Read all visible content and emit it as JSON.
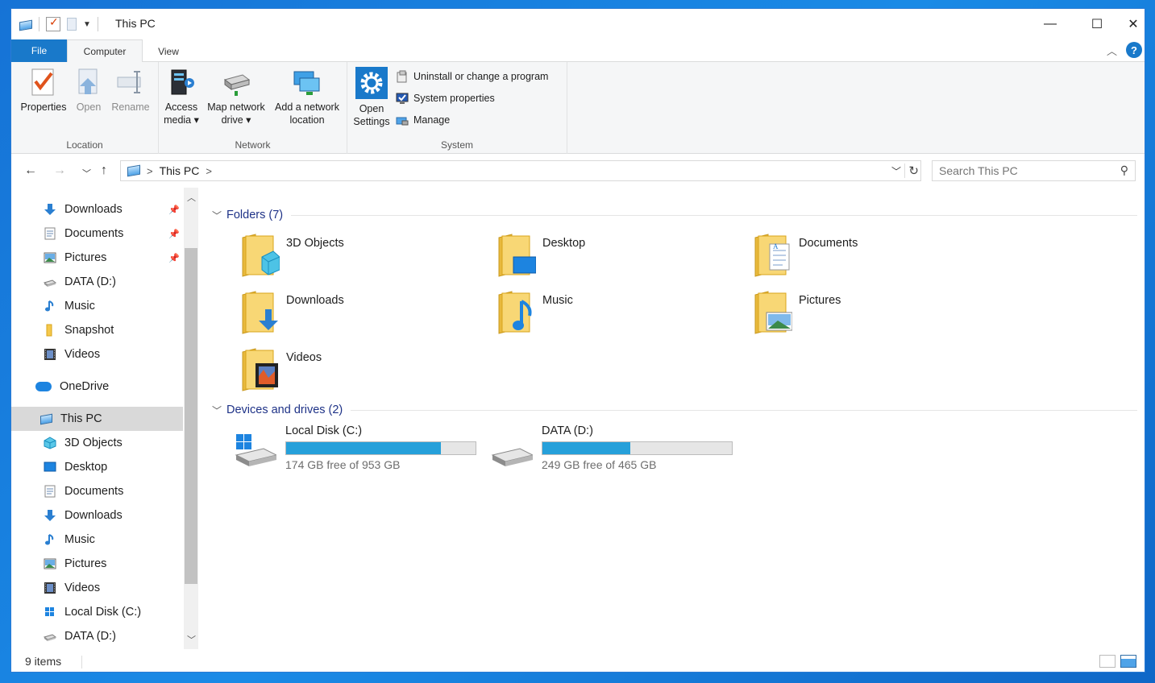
{
  "window": {
    "title": "This PC",
    "controls": {
      "minimize": "—",
      "maximize": "☐",
      "close": "✕"
    }
  },
  "tabs": {
    "file": "File",
    "computer": "Computer",
    "view": "View",
    "help": "?"
  },
  "ribbon": {
    "location": {
      "label": "Location",
      "properties": "Properties",
      "open": "Open",
      "rename": "Rename"
    },
    "network": {
      "label": "Network",
      "access_media_1": "Access",
      "access_media_2": "media ▾",
      "map_drive_1": "Map network",
      "map_drive_2": "drive ▾",
      "add_location_1": "Add a network",
      "add_location_2": "location"
    },
    "system": {
      "label": "System",
      "open_settings_1": "Open",
      "open_settings_2": "Settings",
      "uninstall": "Uninstall or change a program",
      "system_properties": "System properties",
      "manage": "Manage"
    }
  },
  "address": {
    "crumb": "This PC",
    "sep": ">",
    "search_placeholder": "Search This PC"
  },
  "nav_pane": {
    "quick_access": [
      {
        "label": "Downloads",
        "icon": "download-icon",
        "pinned": true
      },
      {
        "label": "Documents",
        "icon": "documents-icon",
        "pinned": true
      },
      {
        "label": "Pictures",
        "icon": "pictures-icon",
        "pinned": true
      },
      {
        "label": "DATA (D:)",
        "icon": "drive-icon",
        "pinned": false
      },
      {
        "label": "Music",
        "icon": "music-icon",
        "pinned": false
      },
      {
        "label": "Snapshot",
        "icon": "folder-icon",
        "pinned": false
      },
      {
        "label": "Videos",
        "icon": "videos-icon",
        "pinned": false
      }
    ],
    "onedrive": "OneDrive",
    "this_pc": "This PC",
    "this_pc_children": [
      {
        "label": "3D Objects"
      },
      {
        "label": "Desktop"
      },
      {
        "label": "Documents"
      },
      {
        "label": "Downloads"
      },
      {
        "label": "Music"
      },
      {
        "label": "Pictures"
      },
      {
        "label": "Videos"
      },
      {
        "label": "Local Disk (C:)"
      },
      {
        "label": "DATA (D:)"
      }
    ]
  },
  "content": {
    "folders_header": "Folders (7)",
    "folders": [
      {
        "name": "3D Objects"
      },
      {
        "name": "Desktop"
      },
      {
        "name": "Documents"
      },
      {
        "name": "Downloads"
      },
      {
        "name": "Music"
      },
      {
        "name": "Pictures"
      },
      {
        "name": "Videos"
      }
    ],
    "drives_header": "Devices and drives (2)",
    "drives": [
      {
        "name": "Local Disk (C:)",
        "free": "174 GB free of 953 GB",
        "used_fraction": 0.817
      },
      {
        "name": "DATA (D:)",
        "free": "249 GB free of 465 GB",
        "used_fraction": 0.465
      }
    ]
  },
  "status": {
    "count": "9 items"
  },
  "colors": {
    "accent": "#1979ca",
    "drive_fill": "#26a0da",
    "section_text": "#1e3287",
    "selection": "#d9d9d9"
  }
}
